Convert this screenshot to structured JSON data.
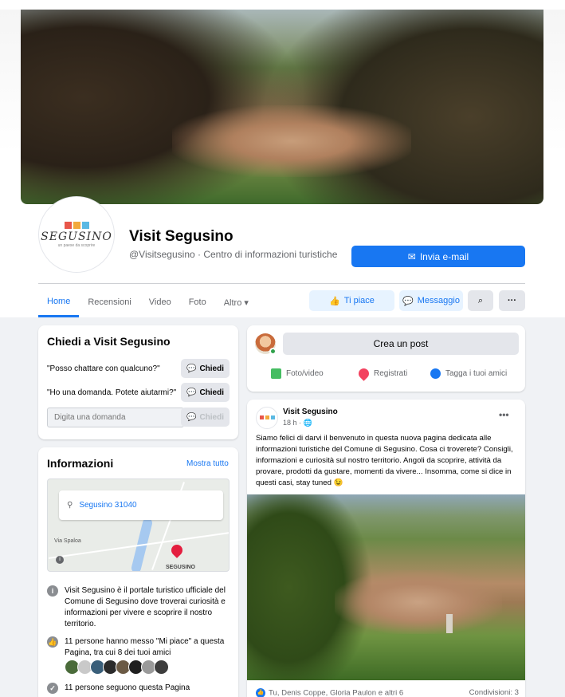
{
  "page": {
    "name": "Visit Segusino",
    "subtitle": "@Visitsegusino · Centro di informazioni turistiche",
    "logo_text": "SEGUSINO",
    "logo_sub": "un paese da scoprire"
  },
  "actions": {
    "email_label": "Invia e-mail",
    "like_label": "Ti piace",
    "message_label": "Messaggio",
    "more_label": "···"
  },
  "nav": {
    "tabs": [
      {
        "label": "Home"
      },
      {
        "label": "Recensioni"
      },
      {
        "label": "Video"
      },
      {
        "label": "Foto"
      },
      {
        "label": "Altro ▾"
      }
    ]
  },
  "ask": {
    "title": "Chiedi a Visit Segusino",
    "questions": [
      {
        "text": "\"Posso chattare con qualcuno?\"",
        "button": "Chiedi"
      },
      {
        "text": "\"Ho una domanda. Potete aiutarmi?\"",
        "button": "Chiedi"
      }
    ],
    "input_placeholder": "Digita una domanda",
    "send_label": "Chiedi"
  },
  "info": {
    "title": "Informazioni",
    "see_all": "Mostra tutto",
    "map_address": "Segusino 31040",
    "map_street": "Via Spaloa",
    "map_town": "SEGUSINO",
    "description": "Visit Segusino è il portale turistico ufficiale del Comune di Segusino dove troverai curiosità e informazioni per vivere e scoprire il nostro territorio.",
    "likes_text": "11 persone hanno messo \"Mi piace\" a questa Pagina, tra cui 8 dei tuoi amici",
    "followers_text": "11 persone seguono questa Pagina"
  },
  "create_post": {
    "button": "Crea un post",
    "photo_video": "Foto/video",
    "check_in": "Registrati",
    "tag_friends": "Tagga i tuoi amici"
  },
  "post": {
    "author": "Visit Segusino",
    "time": "18 h · ",
    "text": "Siamo felici di darvi il benvenuto in questa nuova pagina dedicata alle informazioni turistiche del Comune di Segusino. Cosa ci troverete? Consigli, informazioni e curiosità sul nostro territorio. Angoli da scoprire, attività da provare, prodotti da gustare, momenti da vivere... Insomma, come si dice in questi casi, stay tuned 😉",
    "reactions": "Tu, Denis Coppe, Gloria Paulon e altri 6",
    "shares": "Condivisioni: 3"
  },
  "colors": {
    "accent": "#1877f2",
    "background": "#f0f2f5",
    "logo_blocks": [
      "#e8564a",
      "#f2a93b",
      "#5ab9e3"
    ],
    "friend_avatars": [
      "#4a6b3a",
      "#c9c9c9",
      "#3a5f7a",
      "#2b2b2b",
      "#6b5a45",
      "#1f1f1f",
      "#9a9a9a",
      "#3d3d3d"
    ]
  }
}
